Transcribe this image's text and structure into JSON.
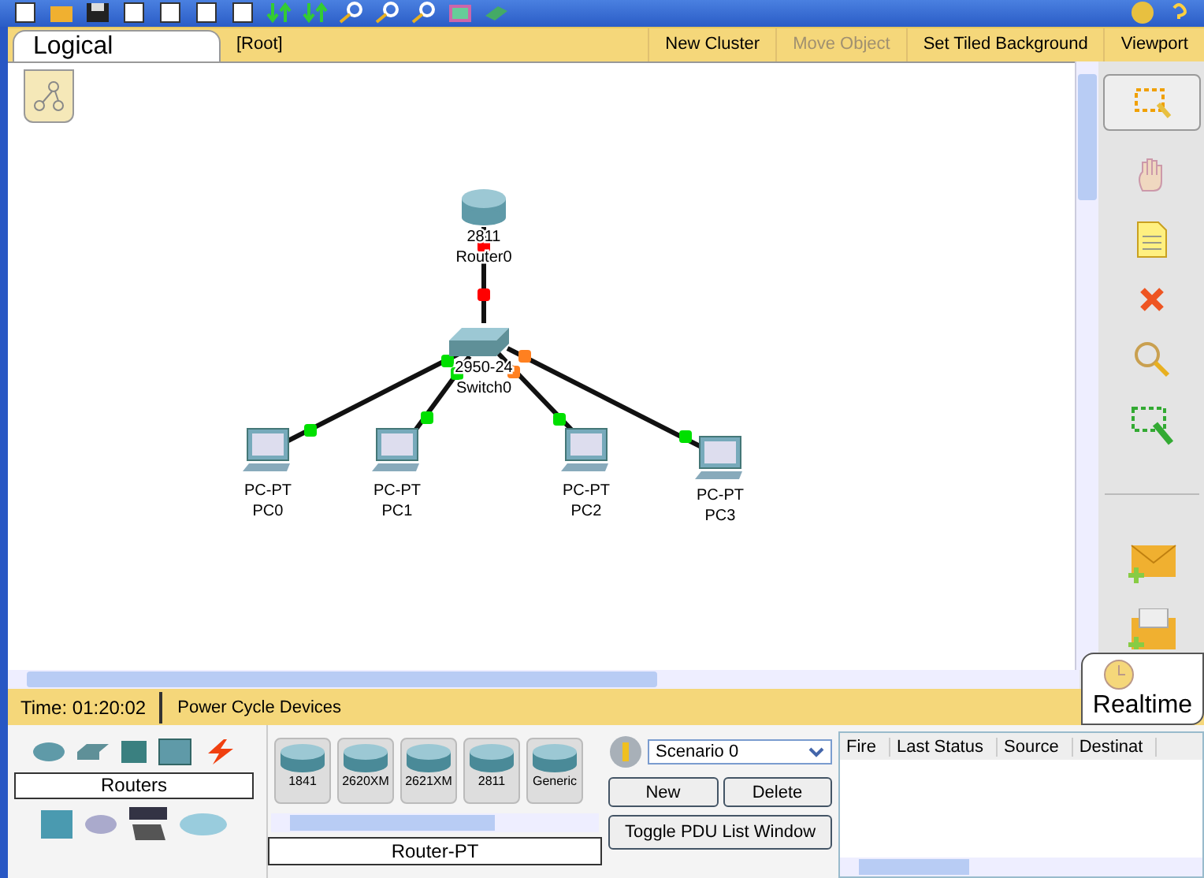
{
  "workspace_bar": {
    "tab": "Logical",
    "path": "[Root]",
    "actions": [
      {
        "label": "New Cluster",
        "disabled": false
      },
      {
        "label": "Move Object",
        "disabled": true
      },
      {
        "label": "Set Tiled Background",
        "disabled": false
      },
      {
        "label": "Viewport",
        "disabled": false
      }
    ]
  },
  "nodes": [
    {
      "kind": "router",
      "model": "2811",
      "name": "Router0"
    },
    {
      "kind": "switch",
      "model": "2950-24",
      "name": "Switch0"
    },
    {
      "kind": "pc",
      "model": "PC-PT",
      "name": "PC0"
    },
    {
      "kind": "pc",
      "model": "PC-PT",
      "name": "PC1"
    },
    {
      "kind": "pc",
      "model": "PC-PT",
      "name": "PC2"
    },
    {
      "kind": "pc",
      "model": "PC-PT",
      "name": "PC3"
    }
  ],
  "links": [
    {
      "ends": [
        {
          "color": "#ff0000"
        },
        {
          "color": "#ff0000"
        }
      ]
    },
    {
      "ends": [
        {
          "color": "#00e000"
        },
        {
          "color": "#00e000"
        }
      ]
    },
    {
      "ends": [
        {
          "color": "#00e000"
        },
        {
          "color": "#00e000"
        }
      ]
    },
    {
      "ends": [
        {
          "color": "#ff8020"
        },
        {
          "color": "#00e000"
        }
      ]
    },
    {
      "ends": [
        {
          "color": "#ff8020"
        },
        {
          "color": "#00e000"
        }
      ]
    }
  ],
  "status_bar": {
    "time": "Time: 01:20:02",
    "power_cycle": "Power Cycle Devices",
    "mode": "Realtime"
  },
  "device_panel": {
    "category": "Routers",
    "models": [
      {
        "label": "1841"
      },
      {
        "label": "2620XM"
      },
      {
        "label": "2621XM"
      },
      {
        "label": "2811"
      },
      {
        "label": "Generic"
      }
    ],
    "model_type": "Router-PT"
  },
  "scenario": {
    "value": "Scenario 0",
    "buttons": [
      "New",
      "Delete"
    ],
    "toggle": "Toggle PDU List Window"
  },
  "pdu_table": {
    "columns": [
      "Fire",
      "Last Status",
      "Source",
      "Destinat"
    ]
  }
}
